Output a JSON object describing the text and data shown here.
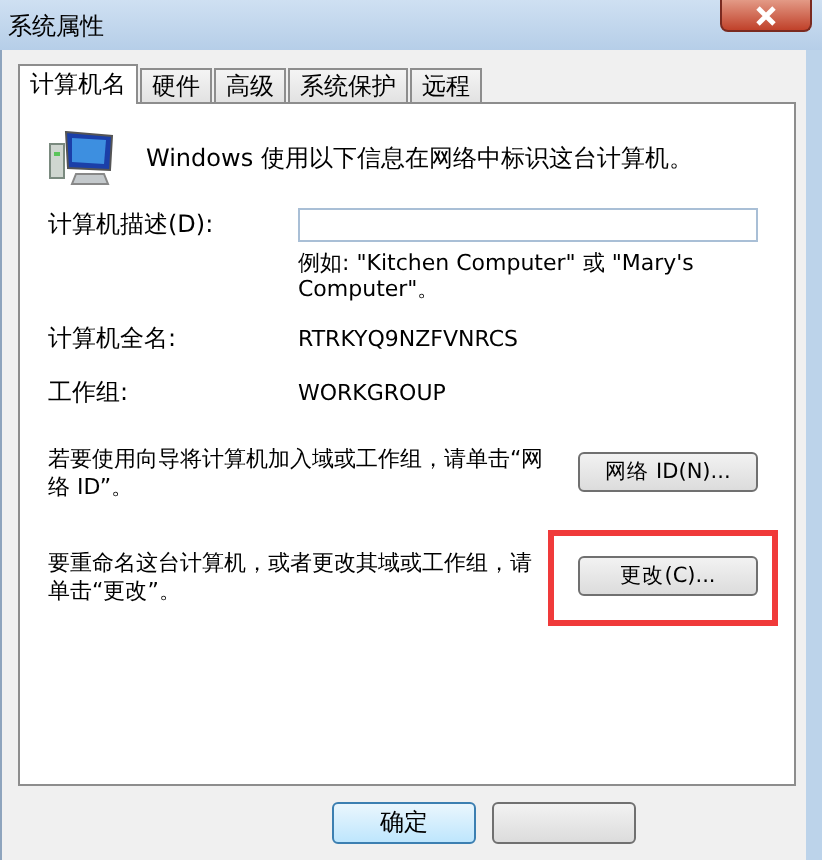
{
  "window": {
    "title": "系统属性"
  },
  "tabs": [
    {
      "label": "计算机名",
      "selected": true
    },
    {
      "label": "硬件",
      "selected": false
    },
    {
      "label": "高级",
      "selected": false
    },
    {
      "label": "系统保护",
      "selected": false
    },
    {
      "label": "远程",
      "selected": false
    }
  ],
  "intro": "Windows 使用以下信息在网络中标识这台计算机。",
  "description": {
    "label": "计算机描述(D):",
    "example": "例如: \"Kitchen Computer\" 或 \"Mary's Computer\"。"
  },
  "fields": [
    {
      "label": "计算机全名:",
      "value": "RTRKYQ9NZFVNRCS"
    },
    {
      "label": "工作组:",
      "value": "WORKGROUP"
    }
  ],
  "actions": [
    {
      "text": "若要使用向导将计算机加入域或工作组，请单击“网络 ID”。",
      "button": "网络 ID(N)...",
      "highlighted": false
    },
    {
      "text": "要重命名这台计算机，或者更改其域或工作组，请单击“更改”。",
      "button": "更改(C)...",
      "highlighted": true
    }
  ],
  "footer_buttons": [
    {
      "label": "确定",
      "default": true
    },
    {
      "default": false
    }
  ]
}
